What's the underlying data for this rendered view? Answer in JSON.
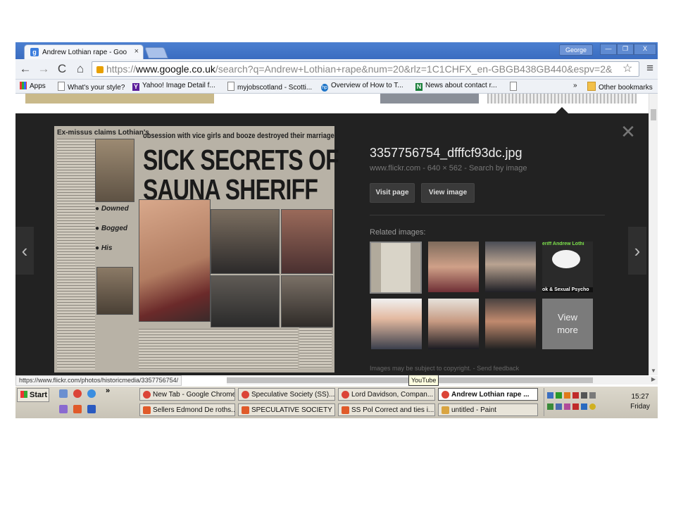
{
  "browser": {
    "tab_title": "Andrew Lothian rape - Googl",
    "tab_close": "×",
    "favicon": "g",
    "user": "George",
    "win_min": "—",
    "win_max": "❐",
    "win_close": "X",
    "url_scheme": "https://",
    "url_host": "www.google.co.uk",
    "url_path": "/search?q=Andrew+Lothian+rape&num=20&rlz=1C1CHFX_en-GBGB438GB440&espv=2&",
    "back": "←",
    "forward": "→",
    "reload": "C",
    "home": "⌂",
    "star": "☆",
    "menu": "≡"
  },
  "bookmarks": {
    "items": [
      "Apps",
      "What's your style?",
      "Yahoo! Image Detail f...",
      "myjobscotland - Scotti...",
      "Overview of How to T...",
      "News about contact r...",
      ""
    ],
    "overflow": "»",
    "other": "Other bookmarks"
  },
  "panel": {
    "close": "✕",
    "image_title": "3357756754_dfffcf93dc.jpg",
    "meta_source": "www.flickr.com",
    "meta_sep": "-",
    "meta_size": "640 × 562",
    "meta_search": "Search by image",
    "visit_label": "Visit page",
    "view_label": "View image",
    "related_label": "Related images:",
    "view_more": [
      "View",
      "more"
    ],
    "copyright": "Images may be subject to copyright.",
    "feedback_sep": "-",
    "feedback": "Send feedback",
    "prev": "‹",
    "next": "›"
  },
  "newspaper": {
    "kicker": "Ex-missus claims Lothian's",
    "strap": "obsession with vice girls and booze destroyed their marriage",
    "headline_1": "SICK SECRETS OF",
    "headline_2": "SAUNA SHERIFF",
    "bullets": [
      "● Downed",
      "● Bogged",
      "● His"
    ]
  },
  "related_thumbs": {
    "t4_caption": "eriff Andrew Lothi",
    "t4_caption2": "ok & Sexual Psycho"
  },
  "status": {
    "hover_url": "https://www.flickr.com/photos/historicmedia/3357756754/",
    "tooltip": "YouTube"
  },
  "taskbar": {
    "start": "Start",
    "quicklaunch_more": "»",
    "row1": [
      "New Tab - Google Chrome",
      "Speculative Society (SS)...",
      "Lord Davidson, Compan...",
      "Andrew Lothian rape ..."
    ],
    "row2": [
      "Sellers Edmond De roths...",
      "SPECULATIVE SOCIETY ...",
      "SS Pol Correct and  ties i...",
      "untitled - Paint"
    ],
    "time": "15:27",
    "day": "Friday"
  },
  "colors": {
    "panel_bg": "#222222",
    "titlebar": "#3a6cc0",
    "chrome_icon": "#db4437"
  }
}
